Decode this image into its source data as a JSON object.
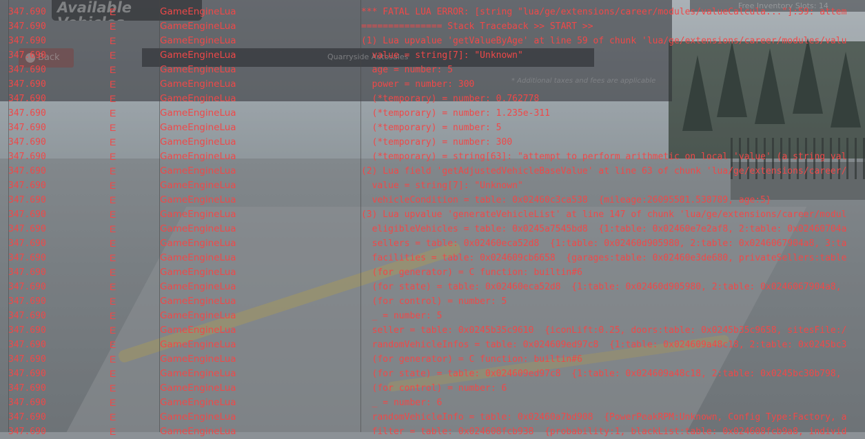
{
  "background_ui": {
    "title": "Available Vehicles",
    "back_label": "Back",
    "facility": "Quarryside Autosales",
    "tax_note": "* Additional taxes and fees are applicable",
    "inventory_slots": "Free Inventory Slots: 14"
  },
  "console": {
    "rows": [
      {
        "time": "347.690",
        "level": "E",
        "source": "GameEngineLua",
        "message": "*** FATAL LUA ERROR: [string \"lua/ge/extensions/career/modules/valueCalcula...\"]:59: attem"
      },
      {
        "time": "347.690",
        "level": "E",
        "source": "GameEngineLua",
        "message": "=============== Stack Traceback >> START >>"
      },
      {
        "time": "347.690",
        "level": "E",
        "source": "GameEngineLua",
        "message": "(1) Lua upvalue 'getValueByAge' at line 59 of chunk 'lua/ge/extensions/career/modules/valu"
      },
      {
        "time": "347.690",
        "level": "E",
        "source": "GameEngineLua",
        "message": "  value = string[7]: \"Unknown\""
      },
      {
        "time": "347.690",
        "level": "E",
        "source": "GameEngineLua",
        "message": "  age = number: 5"
      },
      {
        "time": "347.690",
        "level": "E",
        "source": "GameEngineLua",
        "message": "  power = number: 300"
      },
      {
        "time": "347.690",
        "level": "E",
        "source": "GameEngineLua",
        "message": "  (*temporary) = number: 0.762778"
      },
      {
        "time": "347.690",
        "level": "E",
        "source": "GameEngineLua",
        "message": "  (*temporary) = number: 1.235e-311"
      },
      {
        "time": "347.690",
        "level": "E",
        "source": "GameEngineLua",
        "message": "  (*temporary) = number: 5"
      },
      {
        "time": "347.690",
        "level": "E",
        "source": "GameEngineLua",
        "message": "  (*temporary) = number: 300"
      },
      {
        "time": "347.690",
        "level": "E",
        "source": "GameEngineLua",
        "message": "  (*temporary) = string[63]: \"attempt to perform arithmetic on local 'value' (a string val"
      },
      {
        "time": "347.690",
        "level": "E",
        "source": "GameEngineLua",
        "message": "(2) Lua field 'getAdjustedVehicleBaseValue' at line 63 of chunk 'lua/ge/extensions/career/"
      },
      {
        "time": "347.690",
        "level": "E",
        "source": "GameEngineLua",
        "message": "  value = string[7]: \"Unknown\""
      },
      {
        "time": "347.690",
        "level": "E",
        "source": "GameEngineLua",
        "message": "  vehicleCondition = table: 0x02460c3ca538  {mileage:26095581.538789, age:5}"
      },
      {
        "time": "347.690",
        "level": "E",
        "source": "GameEngineLua",
        "message": "(3) Lua upvalue 'generateVehicleList' at line 147 of chunk 'lua/ge/extensions/career/modul"
      },
      {
        "time": "347.690",
        "level": "E",
        "source": "GameEngineLua",
        "message": "  eligibleVehicles = table: 0x0245a7545bd8  {1:table: 0x02460e7e2af8, 2:table: 0x02460704a"
      },
      {
        "time": "347.690",
        "level": "E",
        "source": "GameEngineLua",
        "message": "  sellers = table: 0x02460eca52d8  {1:table: 0x02460d905980, 2:table: 0x0246067904a8, 3:ta"
      },
      {
        "time": "347.690",
        "level": "E",
        "source": "GameEngineLua",
        "message": "  facilities = table: 0x024609cb6658  {garages:table: 0x02460e3de680, privateSellers:table"
      },
      {
        "time": "347.690",
        "level": "E",
        "source": "GameEngineLua",
        "message": "  (for generator) = C function: builtin#6"
      },
      {
        "time": "347.690",
        "level": "E",
        "source": "GameEngineLua",
        "message": "  (for state) = table: 0x02460eca52d8  {1:table: 0x02460d905980, 2:table: 0x0246067904a8,"
      },
      {
        "time": "347.690",
        "level": "E",
        "source": "GameEngineLua",
        "message": "  (for control) = number: 5"
      },
      {
        "time": "347.690",
        "level": "E",
        "source": "GameEngineLua",
        "message": "  _ = number: 5"
      },
      {
        "time": "347.690",
        "level": "E",
        "source": "GameEngineLua",
        "message": "  seller = table: 0x0245b35c9610  {iconLift:0.25, doors:table: 0x0245b35c9658, sitesFile:/"
      },
      {
        "time": "347.690",
        "level": "E",
        "source": "GameEngineLua",
        "message": "  randomVehicleInfos = table: 0x024609ed97c8  {1:table: 0x024609a48c18, 2:table: 0x0245bc3"
      },
      {
        "time": "347.690",
        "level": "E",
        "source": "GameEngineLua",
        "message": "  (for generator) = C function: builtin#6"
      },
      {
        "time": "347.690",
        "level": "E",
        "source": "GameEngineLua",
        "message": "  (for state) = table: 0x024609ed97c8  {1:table: 0x024609a48c18, 2:table: 0x0245bc30b798,"
      },
      {
        "time": "347.690",
        "level": "E",
        "source": "GameEngineLua",
        "message": "  (for control) = number: 6"
      },
      {
        "time": "347.690",
        "level": "E",
        "source": "GameEngineLua",
        "message": "  _ = number: 6"
      },
      {
        "time": "347.690",
        "level": "E",
        "source": "GameEngineLua",
        "message": "  randomVehicleInfo = table: 0x02460a7bd908  {PowerPeakRPM:Unknown, Config Type:Factory, a"
      },
      {
        "time": "347.690",
        "level": "E",
        "source": "GameEngineLua",
        "message": "  filter = table: 0x024608fcb938  {probability:1, blackList:table: 0x024608fcb9a8, individ"
      }
    ]
  },
  "colors": {
    "error_text": "#f04848"
  }
}
